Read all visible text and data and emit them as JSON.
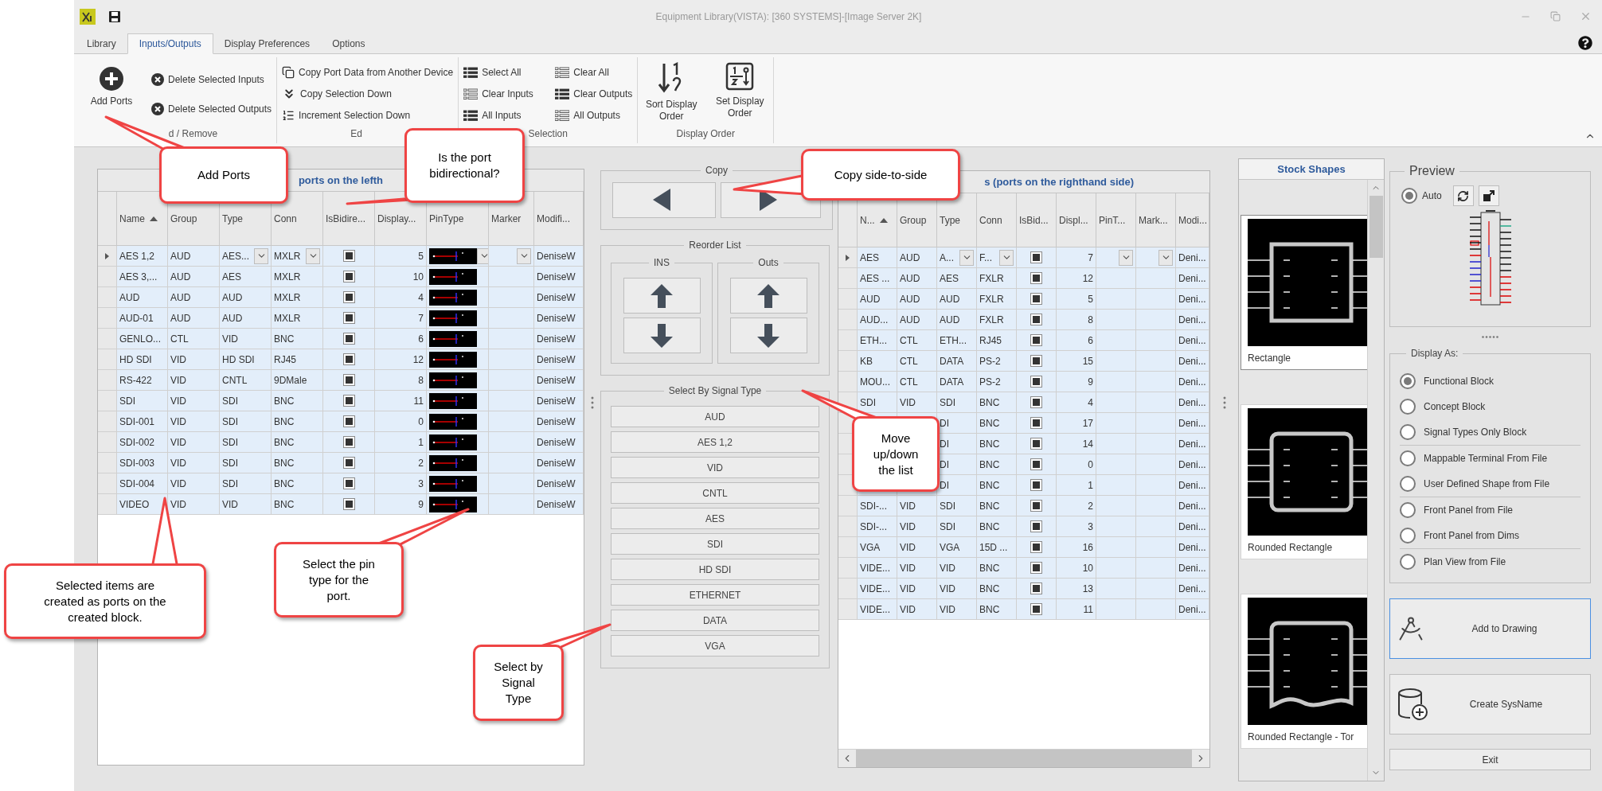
{
  "window": {
    "title": "Equipment Library(VISTA): [360 SYSTEMS]-[Image Server 2K]"
  },
  "tabs": [
    {
      "label": "Library",
      "selected": false
    },
    {
      "label": "Inputs/Outputs",
      "selected": true
    },
    {
      "label": "Display Preferences",
      "selected": false
    },
    {
      "label": "Options",
      "selected": false
    }
  ],
  "ribbon_groups": [
    {
      "label": "d / Remove",
      "items": [
        {
          "kind": "large",
          "label": "Add Ports"
        },
        {
          "kind": "small",
          "label": "Delete Selected Inputs"
        },
        {
          "kind": "small",
          "label": "Delete Selected Outputs"
        }
      ]
    },
    {
      "label": "Ed",
      "items": [
        {
          "kind": "small",
          "label": "Copy Port Data from Another Device"
        },
        {
          "kind": "small",
          "label": "Copy Selection Down"
        },
        {
          "kind": "small",
          "label": "Increment Selection Down"
        }
      ]
    },
    {
      "label": "Selection",
      "items": [
        {
          "kind": "small",
          "label": "Select All"
        },
        {
          "kind": "small",
          "label": "Clear All"
        },
        {
          "kind": "small",
          "label": "Clear Inputs"
        },
        {
          "kind": "small",
          "label": "Clear Outputs"
        },
        {
          "kind": "small",
          "label": "All Inputs"
        },
        {
          "kind": "small",
          "label": "All Outputs"
        }
      ]
    },
    {
      "label": "Display Order",
      "items": [
        {
          "kind": "large",
          "label": "Sort Display Order"
        },
        {
          "kind": "large",
          "label": "Set Display Order"
        }
      ]
    }
  ],
  "inputs_table": {
    "title": "ports on the lefth",
    "columns": [
      {
        "label": "Name",
        "sorted": true
      },
      {
        "label": "Group"
      },
      {
        "label": "Type"
      },
      {
        "label": "Conn"
      },
      {
        "label": "IsBidire..."
      },
      {
        "label": "Display..."
      },
      {
        "label": "PinType"
      },
      {
        "label": "Marker"
      },
      {
        "label": "Modifi..."
      }
    ],
    "rows": [
      {
        "name": "AES 1,2",
        "group": "AUD",
        "type": "AES...",
        "conn": "MXLR",
        "bidirectional": true,
        "display": "5",
        "modified": "DeniseW",
        "selected": true,
        "current": true
      },
      {
        "name": "AES 3,...",
        "group": "AUD",
        "type": "AES",
        "conn": "MXLR",
        "bidirectional": true,
        "display": "10",
        "modified": "DeniseW",
        "selected": true,
        "current": false
      },
      {
        "name": "AUD",
        "group": "AUD",
        "type": "AUD",
        "conn": "MXLR",
        "bidirectional": true,
        "display": "4",
        "modified": "DeniseW",
        "selected": true,
        "current": false
      },
      {
        "name": "AUD-01",
        "group": "AUD",
        "type": "AUD",
        "conn": "MXLR",
        "bidirectional": true,
        "display": "7",
        "modified": "DeniseW",
        "selected": true,
        "current": false
      },
      {
        "name": "GENLO...",
        "group": "CTL",
        "type": "VID",
        "conn": "BNC",
        "bidirectional": true,
        "display": "6",
        "modified": "DeniseW",
        "selected": true,
        "current": false
      },
      {
        "name": "HD SDI",
        "group": "VID",
        "type": "HD SDI",
        "conn": "RJ45",
        "bidirectional": true,
        "display": "12",
        "modified": "DeniseW",
        "selected": true,
        "current": false
      },
      {
        "name": "RS-422",
        "group": "VID",
        "type": "CNTL",
        "conn": "9DMale",
        "bidirectional": true,
        "display": "8",
        "modified": "DeniseW",
        "selected": true,
        "current": false
      },
      {
        "name": "SDI",
        "group": "VID",
        "type": "SDI",
        "conn": "BNC",
        "bidirectional": true,
        "display": "11",
        "modified": "DeniseW",
        "selected": true,
        "current": false
      },
      {
        "name": "SDI-001",
        "group": "VID",
        "type": "SDI",
        "conn": "BNC",
        "bidirectional": true,
        "display": "0",
        "modified": "DeniseW",
        "selected": true,
        "current": false
      },
      {
        "name": "SDI-002",
        "group": "VID",
        "type": "SDI",
        "conn": "BNC",
        "bidirectional": true,
        "display": "1",
        "modified": "DeniseW",
        "selected": true,
        "current": false
      },
      {
        "name": "SDI-003",
        "group": "VID",
        "type": "SDI",
        "conn": "BNC",
        "bidirectional": true,
        "display": "2",
        "modified": "DeniseW",
        "selected": true,
        "current": false
      },
      {
        "name": "SDI-004",
        "group": "VID",
        "type": "SDI",
        "conn": "BNC",
        "bidirectional": true,
        "display": "3",
        "modified": "DeniseW",
        "selected": true,
        "current": false
      },
      {
        "name": "VIDEO",
        "group": "VID",
        "type": "VID",
        "conn": "BNC",
        "bidirectional": true,
        "display": "9",
        "modified": "DeniseW",
        "selected": true,
        "current": false
      }
    ]
  },
  "copy_panel": {
    "title": "Copy"
  },
  "reorder_panel": {
    "title": "Reorder List",
    "groups": [
      {
        "title": "INS"
      },
      {
        "title": "Outs"
      }
    ]
  },
  "signal_panel": {
    "title": "Select By Signal Type",
    "buttons": [
      "AUD",
      "AES 1,2",
      "VID",
      "CNTL",
      "AES",
      "SDI",
      "HD SDI",
      "ETHERNET",
      "DATA",
      "VGA"
    ]
  },
  "outputs_table": {
    "title": "s (ports on the righthand side)",
    "columns": [
      {
        "label": "N...",
        "sorted": true
      },
      {
        "label": "Group"
      },
      {
        "label": "Type"
      },
      {
        "label": "Conn"
      },
      {
        "label": "IsBid..."
      },
      {
        "label": "Displ..."
      },
      {
        "label": "PinT..."
      },
      {
        "label": "Mark..."
      },
      {
        "label": "Modi..."
      }
    ],
    "rows": [
      {
        "name": "AES",
        "group": "AUD",
        "type": "A...",
        "conn": "F...",
        "bidirectional": true,
        "display": "7",
        "modified": "Deni...",
        "selected": true,
        "current": true
      },
      {
        "name": "AES ...",
        "group": "AUD",
        "type": "AES",
        "conn": "FXLR",
        "bidirectional": true,
        "display": "12",
        "modified": "Deni...",
        "selected": true,
        "current": false
      },
      {
        "name": "AUD",
        "group": "AUD",
        "type": "AUD",
        "conn": "FXLR",
        "bidirectional": true,
        "display": "5",
        "modified": "Deni...",
        "selected": true,
        "current": false
      },
      {
        "name": "AUD...",
        "group": "AUD",
        "type": "AUD",
        "conn": "FXLR",
        "bidirectional": true,
        "display": "8",
        "modified": "Deni...",
        "selected": true,
        "current": false
      },
      {
        "name": "ETH...",
        "group": "CTL",
        "type": "ETH...",
        "conn": "RJ45",
        "bidirectional": true,
        "display": "6",
        "modified": "Deni...",
        "selected": true,
        "current": false
      },
      {
        "name": "KB",
        "group": "CTL",
        "type": "DATA",
        "conn": "PS-2",
        "bidirectional": true,
        "display": "15",
        "modified": "Deni...",
        "selected": true,
        "current": false
      },
      {
        "name": "MOU...",
        "group": "CTL",
        "type": "DATA",
        "conn": "PS-2",
        "bidirectional": true,
        "display": "9",
        "modified": "Deni...",
        "selected": true,
        "current": false
      },
      {
        "name": "SDI",
        "group": "VID",
        "type": "SDI",
        "conn": "BNC",
        "bidirectional": true,
        "display": "4",
        "modified": "Deni...",
        "selected": true,
        "current": false
      },
      {
        "type": "DI",
        "conn": "BNC",
        "bidirectional": true,
        "display": "17",
        "modified": "Deni...",
        "selected": true,
        "current": false
      },
      {
        "type": "DI",
        "conn": "BNC",
        "bidirectional": true,
        "display": "14",
        "modified": "Deni...",
        "selected": true,
        "current": false
      },
      {
        "type": "DI",
        "conn": "BNC",
        "bidirectional": true,
        "display": "0",
        "modified": "Deni...",
        "selected": true,
        "current": false
      },
      {
        "type": "DI",
        "conn": "BNC",
        "bidirectional": true,
        "display": "1",
        "modified": "Deni...",
        "selected": true,
        "current": false
      },
      {
        "name": "SDI-...",
        "group": "VID",
        "type": "SDI",
        "conn": "BNC",
        "bidirectional": true,
        "display": "2",
        "modified": "Deni...",
        "selected": true,
        "current": false
      },
      {
        "name": "SDI-...",
        "group": "VID",
        "type": "SDI",
        "conn": "BNC",
        "bidirectional": true,
        "display": "3",
        "modified": "Deni...",
        "selected": true,
        "current": false
      },
      {
        "name": "VGA",
        "group": "VID",
        "type": "VGA",
        "conn": "15D ...",
        "bidirectional": true,
        "display": "16",
        "modified": "Deni...",
        "selected": true,
        "current": false
      },
      {
        "name": "VIDE...",
        "group": "VID",
        "type": "VID",
        "conn": "BNC",
        "bidirectional": true,
        "display": "10",
        "modified": "Deni...",
        "selected": true,
        "current": false
      },
      {
        "name": "VIDE...",
        "group": "VID",
        "type": "VID",
        "conn": "BNC",
        "bidirectional": true,
        "display": "13",
        "modified": "Deni...",
        "selected": true,
        "current": false
      },
      {
        "name": "VIDE...",
        "group": "VID",
        "type": "VID",
        "conn": "BNC",
        "bidirectional": true,
        "display": "11",
        "modified": "Deni...",
        "selected": true,
        "current": false
      }
    ]
  },
  "stock_shapes": {
    "title": "Stock Shapes",
    "items": [
      {
        "label": "Rectangle",
        "kind": "rectangle",
        "selected": true
      },
      {
        "label": "Rounded Rectangle",
        "kind": "rounded",
        "selected": false
      },
      {
        "label": "Rounded Rectangle - Tor",
        "kind": "torn",
        "selected": false
      }
    ]
  },
  "preview": {
    "title": "Preview",
    "auto": {
      "label": "Auto",
      "selected": true
    }
  },
  "display_as": {
    "title": "Display As:",
    "groups": [
      [
        {
          "label": "Functional Block",
          "selected": true
        },
        {
          "label": "Concept Block",
          "selected": false
        },
        {
          "label": "Signal Types Only Block",
          "selected": false
        }
      ],
      [
        {
          "label": "Mappable Terminal From File",
          "selected": false
        },
        {
          "label": "User Defined Shape from File",
          "selected": false
        }
      ],
      [
        {
          "label": "Front Panel from File",
          "selected": false
        },
        {
          "label": "Front Panel from Dims",
          "selected": false
        }
      ],
      [
        {
          "label": "Plan View from File",
          "selected": false
        }
      ]
    ]
  },
  "actions": [
    {
      "label": "Add to Drawing",
      "focused": true
    },
    {
      "label": "Create SysName",
      "focused": false
    }
  ],
  "exit_button": "Exit",
  "callouts": [
    {
      "text": "Add Ports"
    },
    {
      "text": "Is the port\nbidirectional?"
    },
    {
      "text": "Copy side-to-side"
    },
    {
      "text": "Move\nup/down\nthe list"
    },
    {
      "text": "Selected items are\ncreated as ports on the\ncreated block."
    },
    {
      "text": "Select the pin\ntype for the\nport."
    },
    {
      "text": "Select by\nSignal\nType"
    }
  ]
}
